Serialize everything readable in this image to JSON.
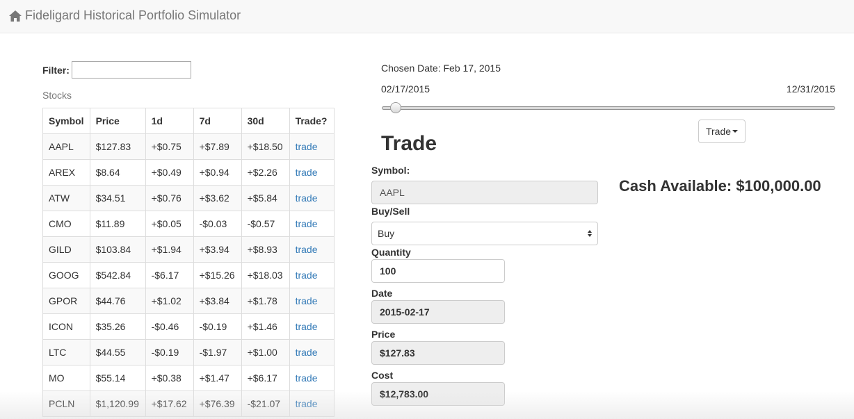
{
  "navbar": {
    "brand": "Fideligard Historical Portfolio Simulator",
    "icon": "home-icon"
  },
  "filter": {
    "label": "Filter:",
    "value": ""
  },
  "stocks": {
    "label": "Stocks",
    "columns": [
      "Symbol",
      "Price",
      "1d",
      "7d",
      "30d",
      "Trade?"
    ],
    "rows": [
      {
        "symbol": "AAPL",
        "price": "$127.83",
        "d1": "+$0.75",
        "d7": "+$7.89",
        "d30": "+$18.50",
        "trade": "trade"
      },
      {
        "symbol": "AREX",
        "price": "$8.64",
        "d1": "+$0.49",
        "d7": "+$0.94",
        "d30": "+$2.26",
        "trade": "trade"
      },
      {
        "symbol": "ATW",
        "price": "$34.51",
        "d1": "+$0.76",
        "d7": "+$3.62",
        "d30": "+$5.84",
        "trade": "trade"
      },
      {
        "symbol": "CMO",
        "price": "$11.89",
        "d1": "+$0.05",
        "d7": "-$0.03",
        "d30": "-$0.57",
        "trade": "trade"
      },
      {
        "symbol": "GILD",
        "price": "$103.84",
        "d1": "+$1.94",
        "d7": "+$3.94",
        "d30": "+$8.93",
        "trade": "trade"
      },
      {
        "symbol": "GOOG",
        "price": "$542.84",
        "d1": "-$6.17",
        "d7": "+$15.26",
        "d30": "+$18.03",
        "trade": "trade"
      },
      {
        "symbol": "GPOR",
        "price": "$44.76",
        "d1": "+$1.02",
        "d7": "+$3.84",
        "d30": "+$1.78",
        "trade": "trade"
      },
      {
        "symbol": "ICON",
        "price": "$35.26",
        "d1": "-$0.46",
        "d7": "-$0.19",
        "d30": "+$1.46",
        "trade": "trade"
      },
      {
        "symbol": "LTC",
        "price": "$44.55",
        "d1": "-$0.19",
        "d7": "-$1.97",
        "d30": "+$1.00",
        "trade": "trade"
      },
      {
        "symbol": "MO",
        "price": "$55.14",
        "d1": "+$0.38",
        "d7": "+$1.47",
        "d30": "+$6.17",
        "trade": "trade"
      },
      {
        "symbol": "PCLN",
        "price": "$1,120.99",
        "d1": "+$17.62",
        "d7": "+$76.39",
        "d30": "-$21.07",
        "trade": "trade"
      }
    ]
  },
  "date_picker": {
    "chosen": "Chosen Date: Feb 17, 2015",
    "start": "02/17/2015",
    "end": "12/31/2015",
    "slider_fraction": 0.0
  },
  "menu": {
    "trade_label": "Trade"
  },
  "trade_form": {
    "title": "Trade",
    "cash": "Cash Available: $100,000.00",
    "symbol_label": "Symbol:",
    "symbol_value": "AAPL",
    "buysell_label": "Buy/Sell",
    "buysell_value": "Buy",
    "quantity_label": "Quantity",
    "quantity_value": "100",
    "date_label": "Date",
    "date_value": "2015-02-17",
    "price_label": "Price",
    "price_value": "$127.83",
    "cost_label": "Cost",
    "cost_value": "$12,783.00"
  },
  "colors": {
    "link": "#337ab7",
    "navbar_bg": "#f8f8f8",
    "readonly_bg": "#eeeeee"
  }
}
